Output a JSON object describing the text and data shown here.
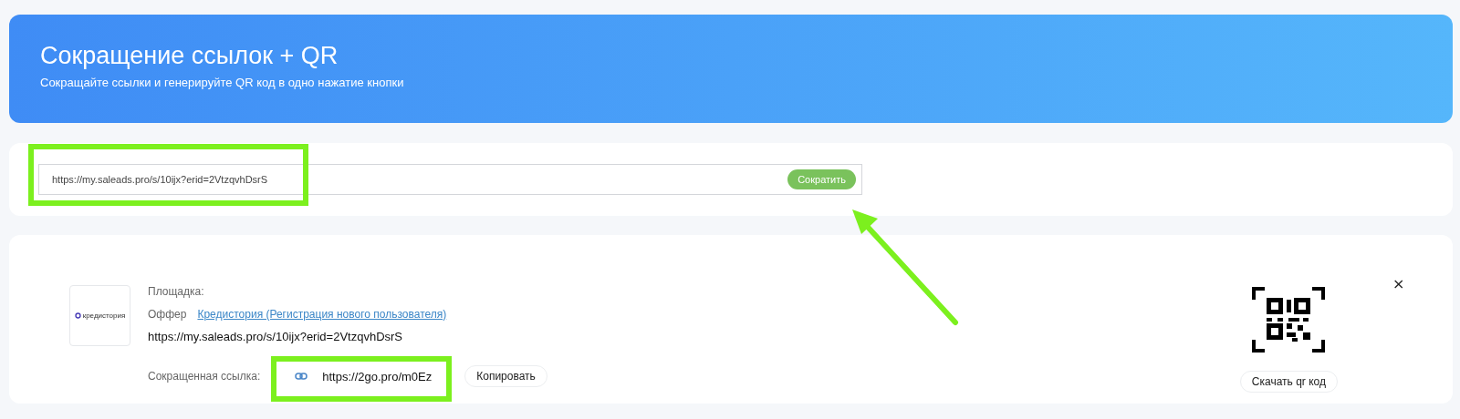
{
  "header": {
    "title": "Сокращение ссылок + QR",
    "subtitle": "Сокращайте ссылки и генерируйте QR код в одно нажатие кнопки"
  },
  "shortener": {
    "value": "https://my.saleads.pro/s/10ijx?erid=2VtzqvhDsrS",
    "button": "Сократить"
  },
  "result": {
    "logo_text": "кредистория",
    "platform_label": "Площадка:",
    "offer_label": "Оффер",
    "offer_link": "Кредистория (Регистрация нового пользователя)",
    "original_url": "https://my.saleads.pro/s/10ijx?erid=2VtzqvhDsrS",
    "short_label": "Сокращенная ссылка:",
    "short_url": "https://2go.pro/m0Ez",
    "copy_button": "Копировать",
    "close": "×",
    "download_button": "Скачать qr код"
  },
  "highlights": [
    {
      "kind": "frame"
    },
    {
      "kind": "frame"
    },
    {
      "kind": "arrow"
    }
  ]
}
